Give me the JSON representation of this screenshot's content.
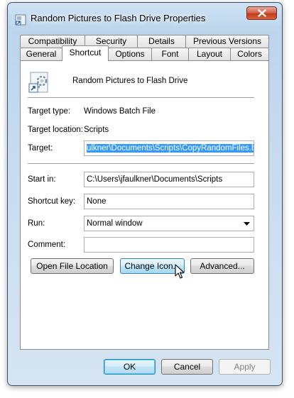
{
  "window": {
    "title": "Random Pictures to Flash Drive Properties"
  },
  "tabs": {
    "row1": [
      "Compatibility",
      "Security",
      "Details",
      "Previous Versions"
    ],
    "row2": [
      "General",
      "Shortcut",
      "Options",
      "Font",
      "Layout",
      "Colors"
    ],
    "active": "Shortcut"
  },
  "shortcut": {
    "name": "Random Pictures to Flash Drive",
    "target_type_label": "Target type:",
    "target_type_value": "Windows Batch File",
    "target_location_label": "Target location:",
    "target_location_value": "Scripts",
    "target_label": "Target:",
    "target_value": "ulkner\\Documents\\Scripts\\CopyRandomFiles.bat",
    "start_in_label": "Start in:",
    "start_in_value": "C:\\Users\\jfaulkner\\Documents\\Scripts",
    "shortcut_key_label": "Shortcut key:",
    "shortcut_key_value": "None",
    "run_label": "Run:",
    "run_value": "Normal window",
    "comment_label": "Comment:",
    "comment_value": ""
  },
  "buttons": {
    "open_file_location": "Open File Location",
    "change_icon": "Change Icon...",
    "advanced": "Advanced...",
    "ok": "OK",
    "cancel": "Cancel",
    "apply": "Apply"
  },
  "icons": {
    "app": "shortcut-properties-icon",
    "shortcut": "batch-file-shortcut-icon",
    "close": "close-icon",
    "dropdown": "chevron-down-icon",
    "cursor": "mouse-pointer-icon"
  }
}
